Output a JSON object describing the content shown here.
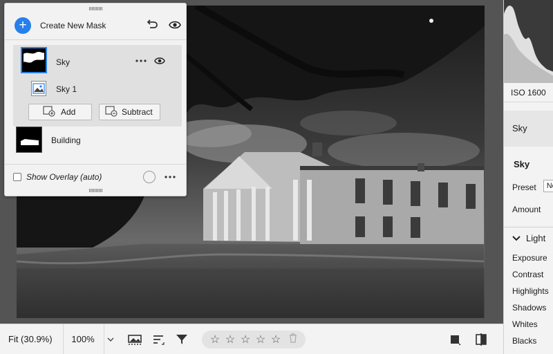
{
  "masks_panel": {
    "create_label": "Create New Mask",
    "masks": [
      {
        "name": "Sky",
        "components": [
          {
            "name": "Sky 1"
          }
        ]
      },
      {
        "name": "Building"
      }
    ],
    "add_label": "Add",
    "subtract_label": "Subtract",
    "overlay_label": "Show Overlay (auto)"
  },
  "bottom_bar": {
    "fit_label": "Fit (30.9%)",
    "zoom_value": "100%",
    "rating_stars": [
      "☆",
      "☆",
      "☆",
      "☆",
      "☆"
    ]
  },
  "right_panel": {
    "iso": "ISO 1600",
    "selected_mask": "Sky",
    "section_title": "Sky",
    "preset_label": "Preset",
    "preset_value": "No",
    "amount_label": "Amount",
    "light_label": "Light",
    "light_items": [
      "Exposure",
      "Contrast",
      "Highlights",
      "Shadows",
      "Whites",
      "Blacks"
    ]
  },
  "colors": {
    "accent": "#2680eb",
    "panel_bg": "#f2f2f2",
    "canvas_bg": "#545454"
  },
  "icons": [
    "plus-icon",
    "reset-icon",
    "eye-icon",
    "more-icon",
    "chevron-down-icon",
    "filmstrip-icon",
    "sort-icon",
    "filter-icon",
    "star-icon",
    "trash-icon",
    "crop-icon",
    "compare-icon"
  ]
}
